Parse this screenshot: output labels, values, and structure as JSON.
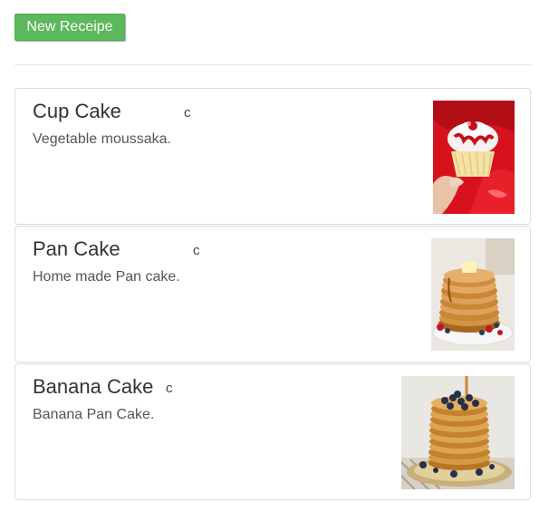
{
  "toolbar": {
    "new_label": "New Receipe",
    "accent_color": "#5cb85c"
  },
  "recipes": [
    {
      "title": "Cup Cake",
      "extra": "c",
      "description": "Vegetable moussaka.",
      "image": "cupcake-photo"
    },
    {
      "title": "Pan Cake",
      "extra": "c",
      "description": "Home made Pan cake.",
      "image": "pancake-photo"
    },
    {
      "title": "Banana Cake",
      "extra": "c",
      "description": "Banana Pan Cake.",
      "image": "banana-pancake-photo"
    }
  ]
}
